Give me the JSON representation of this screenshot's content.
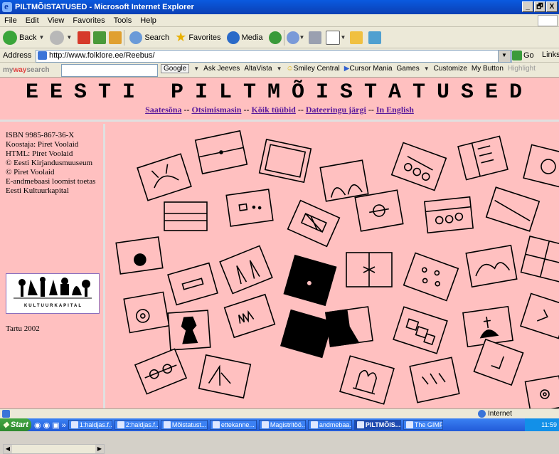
{
  "window": {
    "title": "PILTMÕISTATUSED - Microsoft Internet Explorer",
    "buttons": [
      "_",
      "🗗",
      "X"
    ]
  },
  "menu": [
    "File",
    "Edit",
    "View",
    "Favorites",
    "Tools",
    "Help"
  ],
  "toolbar": {
    "back": "Back",
    "search": "Search",
    "favorites": "Favorites",
    "media": "Media"
  },
  "address": {
    "label": "Address",
    "url": "http://www.folklore.ee/Reebus/",
    "go": "Go",
    "links": "Links"
  },
  "searchbar": {
    "brand_my": "my",
    "brand_way": "way",
    "brand_search": "search",
    "items": [
      "Google",
      "Ask Jeeves",
      "AltaVista",
      "Smiley Central",
      "Cursor Mania",
      "Games",
      "Customize",
      "My Button",
      "Highlight"
    ]
  },
  "page": {
    "title": "EESTI PILTMÕISTATUSED",
    "nav": [
      "Saatesõna",
      "Otsimismasin",
      "Kõik tüübid",
      "Dateeringu järgi",
      "In English"
    ],
    "nav_sep": "--",
    "info": [
      "ISBN 9985-867-36-X",
      "Koostaja: Piret Voolaid",
      "HTML: Piret Voolaid",
      "© Eesti Kirjandusmuuseum",
      "© Piret Voolaid",
      "E-andmebaasi loomist toetas Eesti Kultuurkapital"
    ],
    "sponsor": "KULTUURKAPITAL",
    "place_year": "Tartu 2002"
  },
  "status": {
    "zone": "Internet"
  },
  "taskbar": {
    "start": "Start",
    "items": [
      "1:haldjas.f...",
      "2:haldjas.f...",
      "Mõistatust...",
      "ettekanne...",
      "Magistritöö...",
      "andmebaa...",
      "PILTMÕIS...",
      "The GIMP"
    ],
    "active_index": 6,
    "clock": "11:59"
  }
}
